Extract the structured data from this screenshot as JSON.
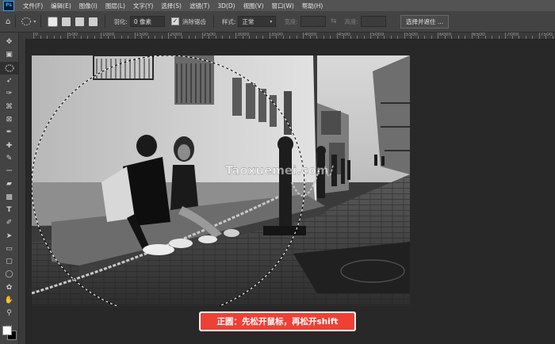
{
  "menu": [
    "文件(F)",
    "编辑(E)",
    "图像(I)",
    "图层(L)",
    "文字(Y)",
    "选择(S)",
    "滤镜(T)",
    "3D(D)",
    "视图(V)",
    "窗口(W)",
    "帮助(H)"
  ],
  "app_logo": "Ps",
  "options": {
    "feather_label": "羽化:",
    "feather_value": "0 像素",
    "antialias_label": "消除锯齿",
    "antialias_checked": true,
    "style_label": "样式:",
    "style_value": "正常",
    "width_label": "宽度:",
    "height_label": "高度:",
    "select_mask_button": "选择并遮住 ..."
  },
  "ruler_numbers": [
    "0",
    "500",
    "1000",
    "1500",
    "2000",
    "2500",
    "3000",
    "3500",
    "4000",
    "4500",
    "5000",
    "5500",
    "6000",
    "6500",
    "7000",
    "7500",
    "800"
  ],
  "photo": {
    "watermark": "Taoxuemei.com"
  },
  "caption": "正圆：先松开鼠标，再松开shift",
  "colors": {
    "menubar": "#535353",
    "panel": "#434343",
    "workspace": "#282828",
    "caption_bg": "#ef4035"
  }
}
